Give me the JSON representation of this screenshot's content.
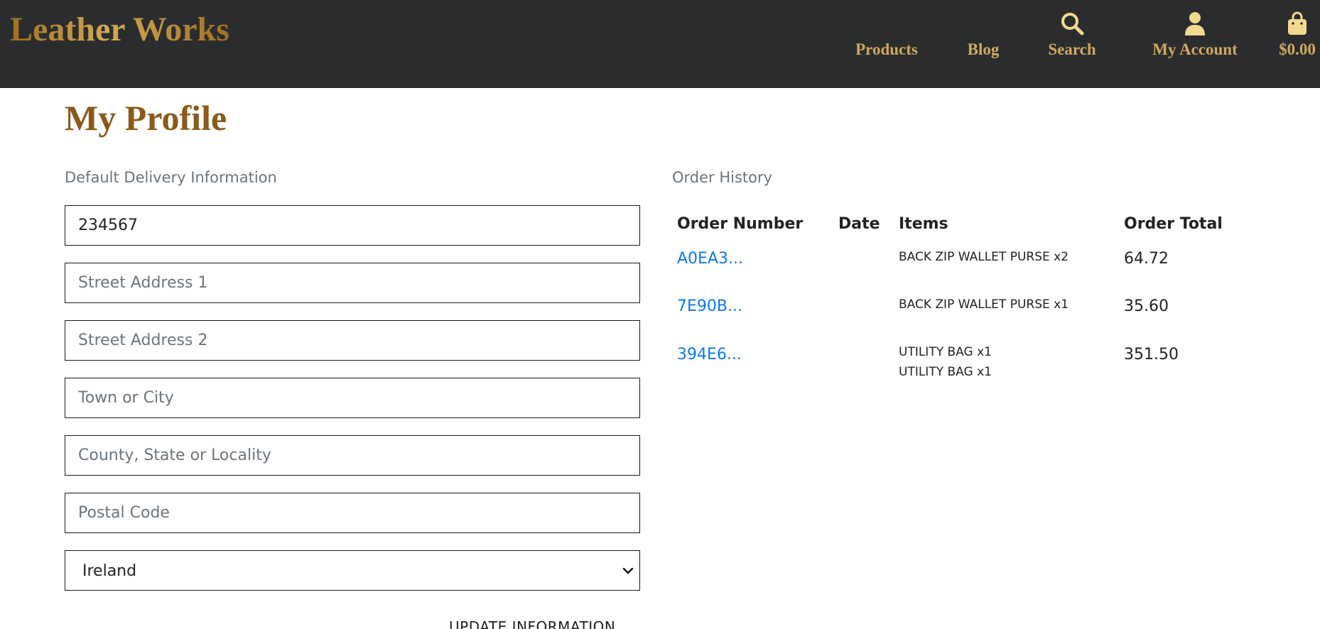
{
  "brand": {
    "name": "Leather Works"
  },
  "nav": {
    "products": "Products",
    "blog": "Blog",
    "search": "Search",
    "account": "My Account",
    "bag_total": "$0.00"
  },
  "page": {
    "title": "My Profile"
  },
  "delivery": {
    "section_label": "Default Delivery Information",
    "phone_value": "234567",
    "street1_placeholder": "Street Address 1",
    "street2_placeholder": "Street Address 2",
    "town_placeholder": "Town or City",
    "county_placeholder": "County, State or Locality",
    "postcode_placeholder": "Postal Code",
    "country_selected": "Ireland",
    "update_button": "UPDATE INFORMATION"
  },
  "history": {
    "section_label": "Order History",
    "headers": {
      "number": "Order Number",
      "date": "Date",
      "items": "Items",
      "total": "Order Total"
    },
    "orders": [
      {
        "number": "A0EA3...",
        "items": [
          "BACK ZIP WALLET PURSE x2"
        ],
        "total": "64.72"
      },
      {
        "number": "7E90B...",
        "items": [
          "BACK ZIP WALLET PURSE x1"
        ],
        "total": "35.60"
      },
      {
        "number": "394E6...",
        "items": [
          "UTILITY BAG x1",
          "UTILITY BAG x1"
        ],
        "total": "351.50"
      }
    ]
  },
  "colors": {
    "topbar": "#2b2c2e",
    "gold": "#cfa95c",
    "title": "#8a5a1a",
    "link": "#0d7ae6"
  },
  "icons": {
    "search": "search-icon",
    "account": "user-icon",
    "bag": "shopping-bag-icon",
    "select": "chevron-down-icon"
  }
}
